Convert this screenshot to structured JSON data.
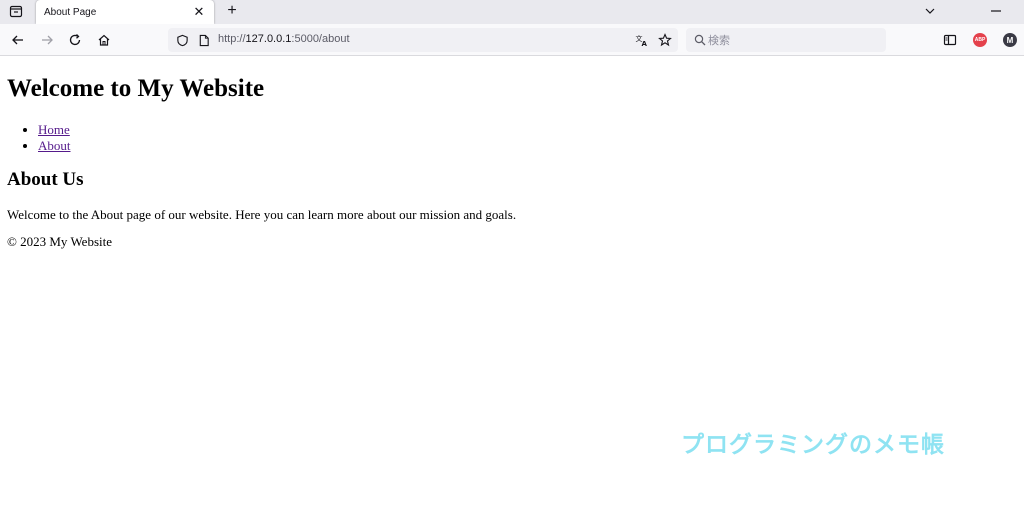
{
  "browser": {
    "tab": {
      "title": "About Page",
      "close_glyph": "✕"
    },
    "new_tab_glyph": "+",
    "url": {
      "scheme": "http://",
      "host": "127.0.0.1",
      "rest": ":5000/about"
    },
    "search": {
      "placeholder": "検索"
    },
    "extensions": {
      "abp_label": "ABP",
      "profile_initial": "M"
    },
    "icons": [
      "tab-manager-icon",
      "close-icon",
      "plus-icon",
      "chevron-down-icon",
      "minimize-icon",
      "back-arrow-icon",
      "forward-arrow-icon",
      "reload-icon",
      "home-icon",
      "shield-icon",
      "page-icon",
      "translate-icon",
      "star-icon",
      "search-icon",
      "sidebar-icon"
    ]
  },
  "page": {
    "heading": "Welcome to My Website",
    "nav": [
      {
        "label": "Home"
      },
      {
        "label": "About"
      }
    ],
    "section_heading": "About Us",
    "paragraph": "Welcome to the About page of our website. Here you can learn more about our mission and goals.",
    "footer": "© 2023 My Website"
  },
  "watermark": "プログラミングのメモ帳",
  "colors": {
    "link_visited": "#551a8b",
    "watermark": "#8fe3f2",
    "chrome_bg": "#e9e9ee",
    "abp_red": "#e4414c"
  }
}
